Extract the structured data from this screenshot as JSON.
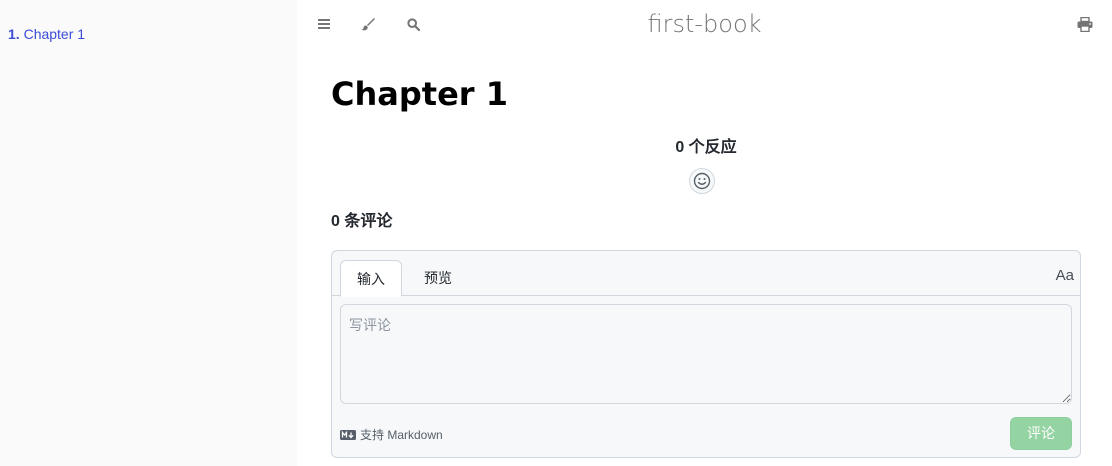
{
  "sidebar": {
    "items": [
      {
        "number": "1.",
        "label": "Chapter 1"
      }
    ]
  },
  "menu_bar": {
    "book_title": "first-book",
    "icons": [
      "menu-icon",
      "paintbrush-icon",
      "search-icon",
      "print-icon"
    ]
  },
  "content": {
    "chapter_title": "Chapter 1"
  },
  "reactions": {
    "header": "0 个反应",
    "add_reaction_icon": "smiley-icon"
  },
  "comments": {
    "header": "0 条评论",
    "tabs": [
      {
        "label": "输入",
        "active": true
      },
      {
        "label": "预览",
        "active": false
      }
    ],
    "font_toggle_label": "Aa",
    "textarea_placeholder": "写评论",
    "markdown_hint": "支持 Markdown",
    "submit_label": "评论"
  },
  "colors": {
    "link": "#3b4dd6",
    "submit_disabled": "#94d3a2",
    "sidebar_bg": "#fafafa"
  }
}
